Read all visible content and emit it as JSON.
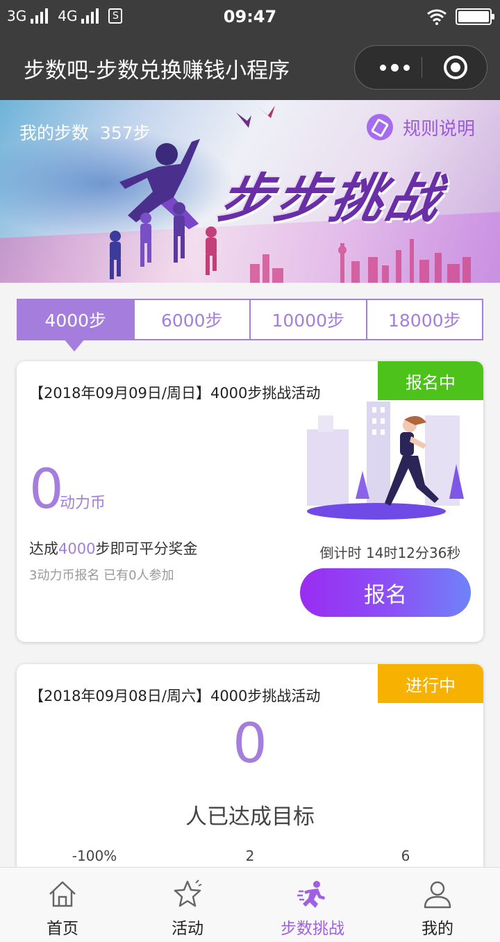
{
  "status_bar": {
    "network1": "3G",
    "network2": "4G",
    "sim_icon": "S",
    "time": "09:47"
  },
  "navbar": {
    "title": "步数吧-步数兑换赚钱小程序",
    "icons": [
      "more-icon",
      "close-target-icon"
    ]
  },
  "banner": {
    "my_steps_label": "我的步数",
    "my_steps_value": "357步",
    "rules_label": "规则说明",
    "headline": "步步挑战"
  },
  "tabs": [
    {
      "label": "4000步",
      "active": true
    },
    {
      "label": "6000步",
      "active": false
    },
    {
      "label": "10000步",
      "active": false
    },
    {
      "label": "18000步",
      "active": false
    }
  ],
  "cards": [
    {
      "title": "【2018年09月09日/周日】4000步挑战活动",
      "status": "报名中",
      "status_color": "#4cc21a",
      "coins_value": "0",
      "coins_unit": "动力币",
      "desc_prefix": "达成",
      "desc_steps": "4000",
      "desc_suffix": "步即可平分奖金",
      "sub": "3动力币报名 已有0人参加",
      "countdown": "倒计时 14时12分36秒",
      "button": "报名"
    },
    {
      "title": "【2018年09月08日/周六】4000步挑战活动",
      "status": "进行中",
      "status_color": "#f7b100",
      "reached_count": "0",
      "reached_label": "人已达成目标",
      "stats": [
        "-100%",
        "2",
        "6"
      ]
    }
  ],
  "tabbar": [
    {
      "label": "首页",
      "icon": "home-icon",
      "active": false
    },
    {
      "label": "活动",
      "icon": "star-icon",
      "active": false
    },
    {
      "label": "步数挑战",
      "icon": "runner-icon",
      "active": true
    },
    {
      "label": "我的",
      "icon": "user-icon",
      "active": false
    }
  ],
  "colors": {
    "accent": "#a57ddc",
    "header_bg": "#3d3d3d",
    "button_gradient_start": "#9a2cf2",
    "button_gradient_end": "#6f83f8"
  }
}
